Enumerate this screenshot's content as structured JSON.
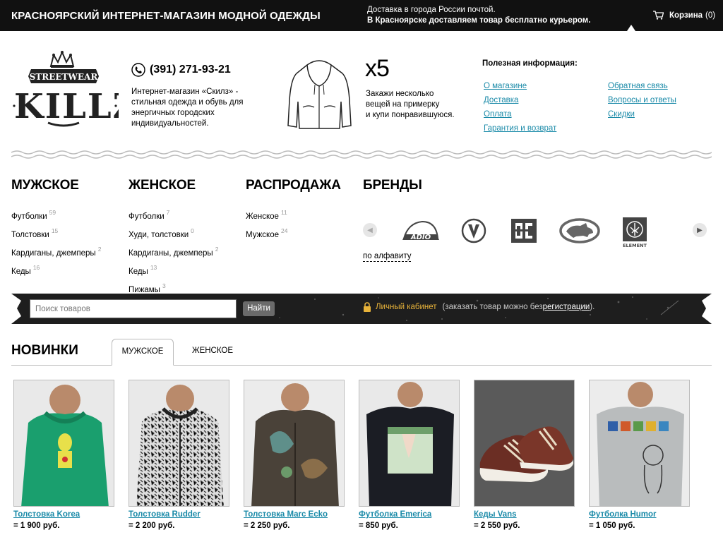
{
  "topbar": {
    "title": "КРАСНОЯРСКИЙ ИНТЕРНЕТ-МАГАЗИН МОДНОЙ ОДЕЖДЫ",
    "delivery_line1": "Доставка в города России почтой.",
    "delivery_line2": "В Красноярске доставляем товар бесплатно курьером.",
    "cart_label": "Корзина",
    "cart_count": "(0)"
  },
  "header": {
    "logo_top": "STREETWEAR",
    "logo_main": "SKILLZ",
    "phone": "(391) 271-93-21",
    "about": "Интернет-магазин «Скилз» - стильная одежда и обувь для энергичных городских индивидуальностей.",
    "x5": "x5",
    "x5_line1": "Закажи несколько",
    "x5_line2": "вещей на примерку",
    "x5_line3": "и купи понравившуюся.",
    "info_title": "Полезная информация:",
    "info_col1": [
      "О магазине",
      "Доставка",
      "Оплата",
      "Гарантия и возврат"
    ],
    "info_col2": [
      "Обратная связь",
      "Вопросы и ответы",
      "Скидки"
    ]
  },
  "categories": {
    "men": {
      "title": "МУЖСКОЕ",
      "items": [
        {
          "label": "Футболки",
          "count": "59"
        },
        {
          "label": "Толстовки",
          "count": "15"
        },
        {
          "label": "Кардиганы, джемперы",
          "count": "2"
        },
        {
          "label": "Кеды",
          "count": "16"
        }
      ]
    },
    "women": {
      "title": "ЖЕНСКОЕ",
      "items": [
        {
          "label": "Футболки",
          "count": "7"
        },
        {
          "label": "Худи, толстовки",
          "count": "0"
        },
        {
          "label": "Кардиганы, джемперы",
          "count": "2"
        },
        {
          "label": "Кеды",
          "count": "13"
        },
        {
          "label": "Пижамы",
          "count": "3"
        }
      ]
    },
    "sale": {
      "title": "РАСПРОДАЖА",
      "items": [
        {
          "label": "Женское",
          "count": "11"
        },
        {
          "label": "Мужское",
          "count": "24"
        }
      ]
    },
    "brands": {
      "title": "БРЕНДЫ",
      "logos": [
        "adio-logo",
        "volcom-logo",
        "dc-logo",
        "ecko-logo",
        "element-logo"
      ],
      "element_text": "ELEMENT",
      "alpha_link": "по алфавиту"
    }
  },
  "search": {
    "placeholder": "Поиск товаров",
    "button": "Найти",
    "cabinet": "Личный кабинет",
    "note_prefix": "(заказать товар можно без ",
    "note_link": "регистрации",
    "note_suffix": ")."
  },
  "new_arrivals": {
    "title": "НОВИНКИ",
    "tabs": [
      "МУЖСКОЕ",
      "ЖЕНСКОЕ"
    ],
    "products": [
      {
        "name": "Толстовка Korea",
        "price": "= 1 900 руб."
      },
      {
        "name": "Толстовка Rudder",
        "price": "= 2 200 руб."
      },
      {
        "name": "Толстовка Marc Ecko",
        "price": "= 2 250 руб."
      },
      {
        "name": "Футболка Emerica",
        "price": "= 850 руб."
      },
      {
        "name": "Кеды Vans",
        "price": "= 2 550 руб."
      },
      {
        "name": "Футболка Humor",
        "price": "= 1 050 руб."
      }
    ]
  },
  "colors": {
    "link": "#1a8aa8",
    "topbar_bg": "#111111",
    "cabinet_accent": "#e8b33a"
  }
}
